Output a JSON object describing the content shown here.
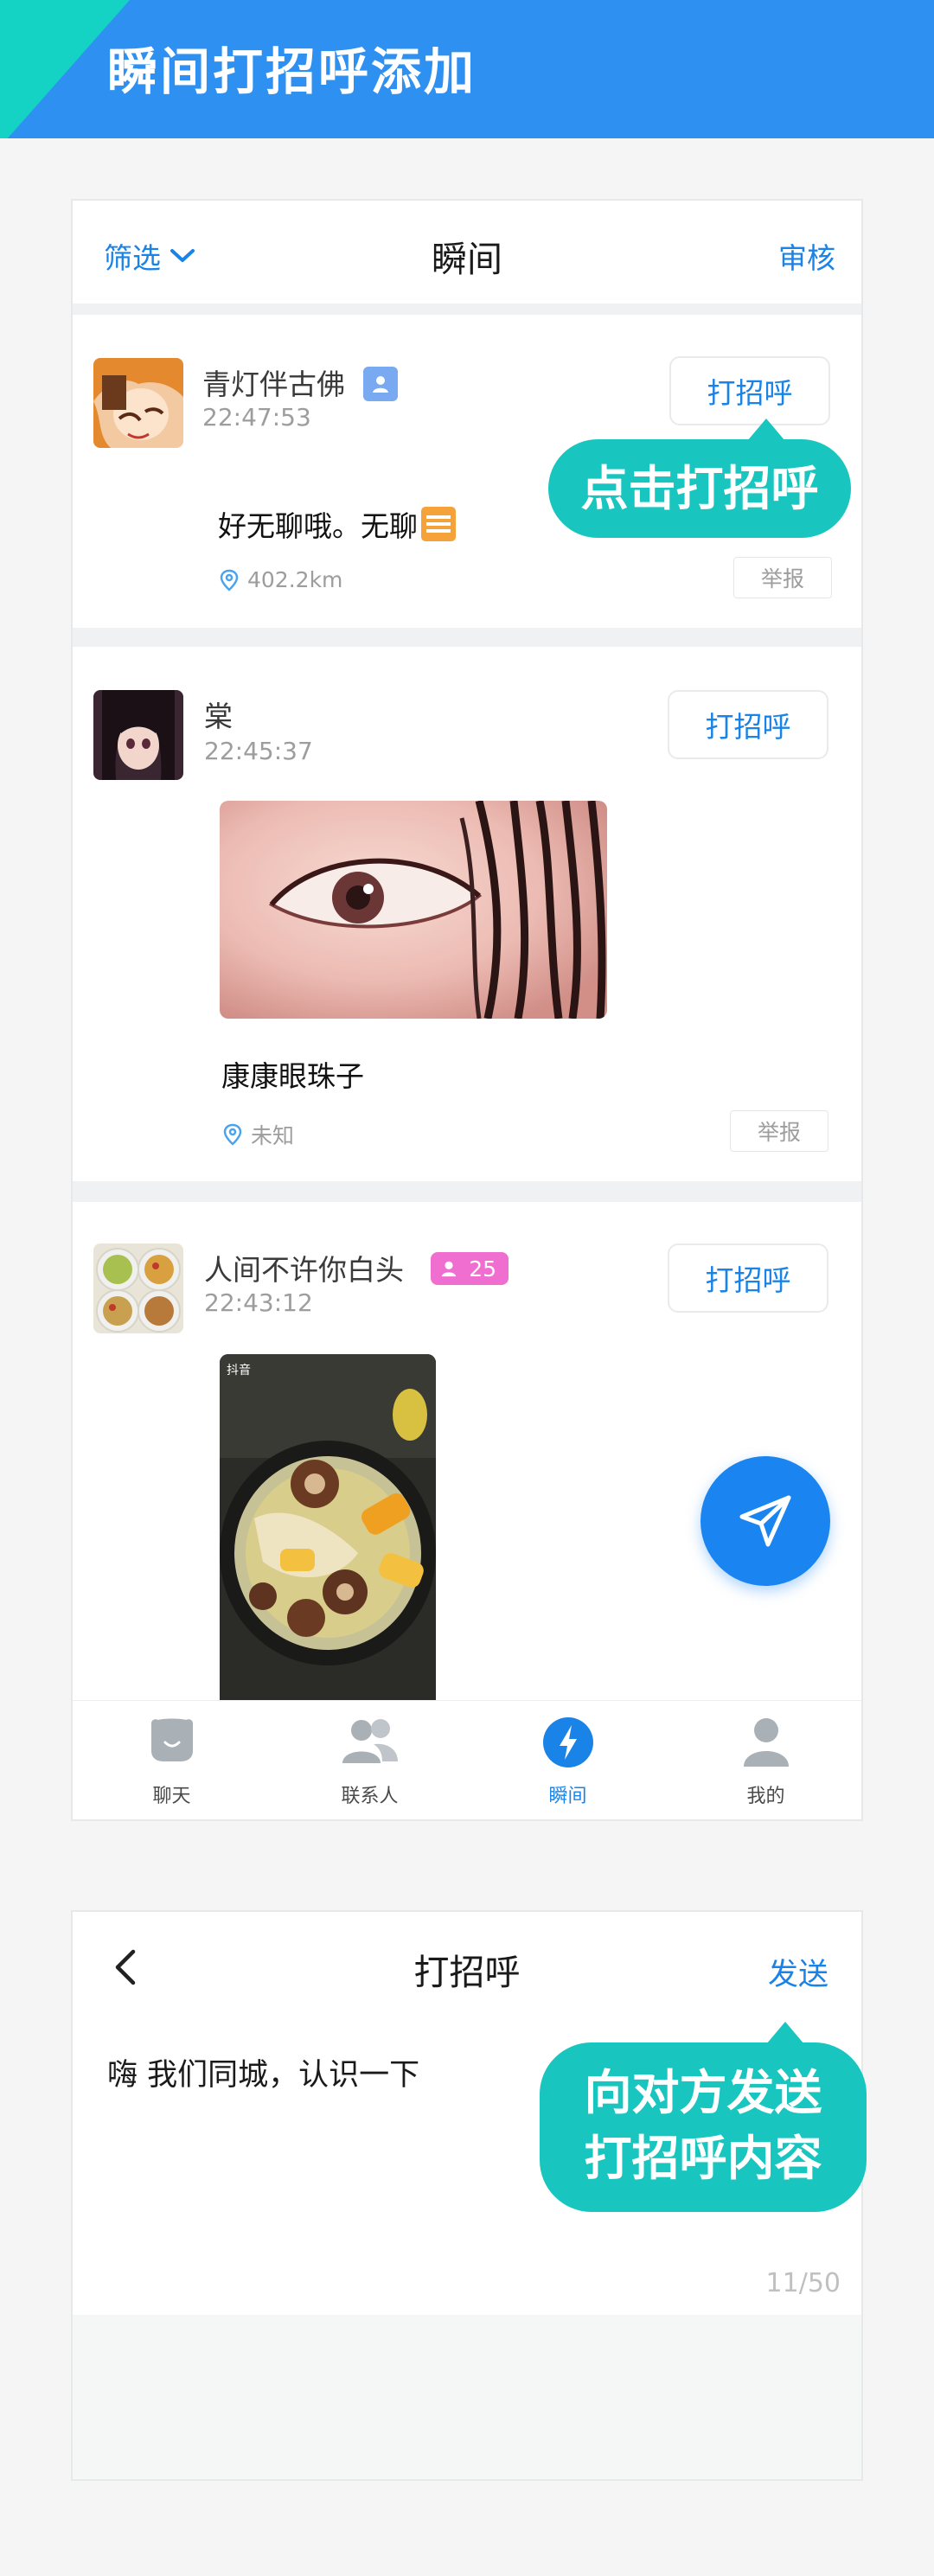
{
  "banner": {
    "title": "瞬间打招呼添加"
  },
  "moments_screen": {
    "header": {
      "filter_label": "筛选",
      "title": "瞬间",
      "audit_label": "审核"
    },
    "posts": [
      {
        "username": "青灯伴古佛",
        "time": "22:47:53",
        "greet_label": "打招呼",
        "text": "好无聊哦。无聊",
        "location": "402.2km",
        "report_label": "举报"
      },
      {
        "username": "棠",
        "time": "22:45:37",
        "greet_label": "打招呼",
        "text": "康康眼珠子",
        "location": "未知",
        "report_label": "举报"
      },
      {
        "username": "人间不许你白头",
        "time": "22:43:12",
        "greet_label": "打招呼",
        "badge_age": "25",
        "video_watermark": "抖音"
      }
    ],
    "callout": "点击打招呼",
    "nav": [
      {
        "label": "聊天",
        "icon": "chat-bubble-icon"
      },
      {
        "label": "联系人",
        "icon": "contacts-icon"
      },
      {
        "label": "瞬间",
        "icon": "lightning-icon"
      },
      {
        "label": "我的",
        "icon": "person-icon"
      }
    ],
    "fab_icon": "send-plane-icon"
  },
  "greet_screen": {
    "title": "打招呼",
    "send_label": "发送",
    "message": "嗨 我们同城，认识一下",
    "counter": "11/50",
    "callout_line1": "向对方发送",
    "callout_line2": "打招呼内容"
  },
  "colors": {
    "banner": "#2e90f1",
    "banner_corner": "#14d2c4",
    "accent": "#1a83e8",
    "callout": "#19c6bf"
  }
}
